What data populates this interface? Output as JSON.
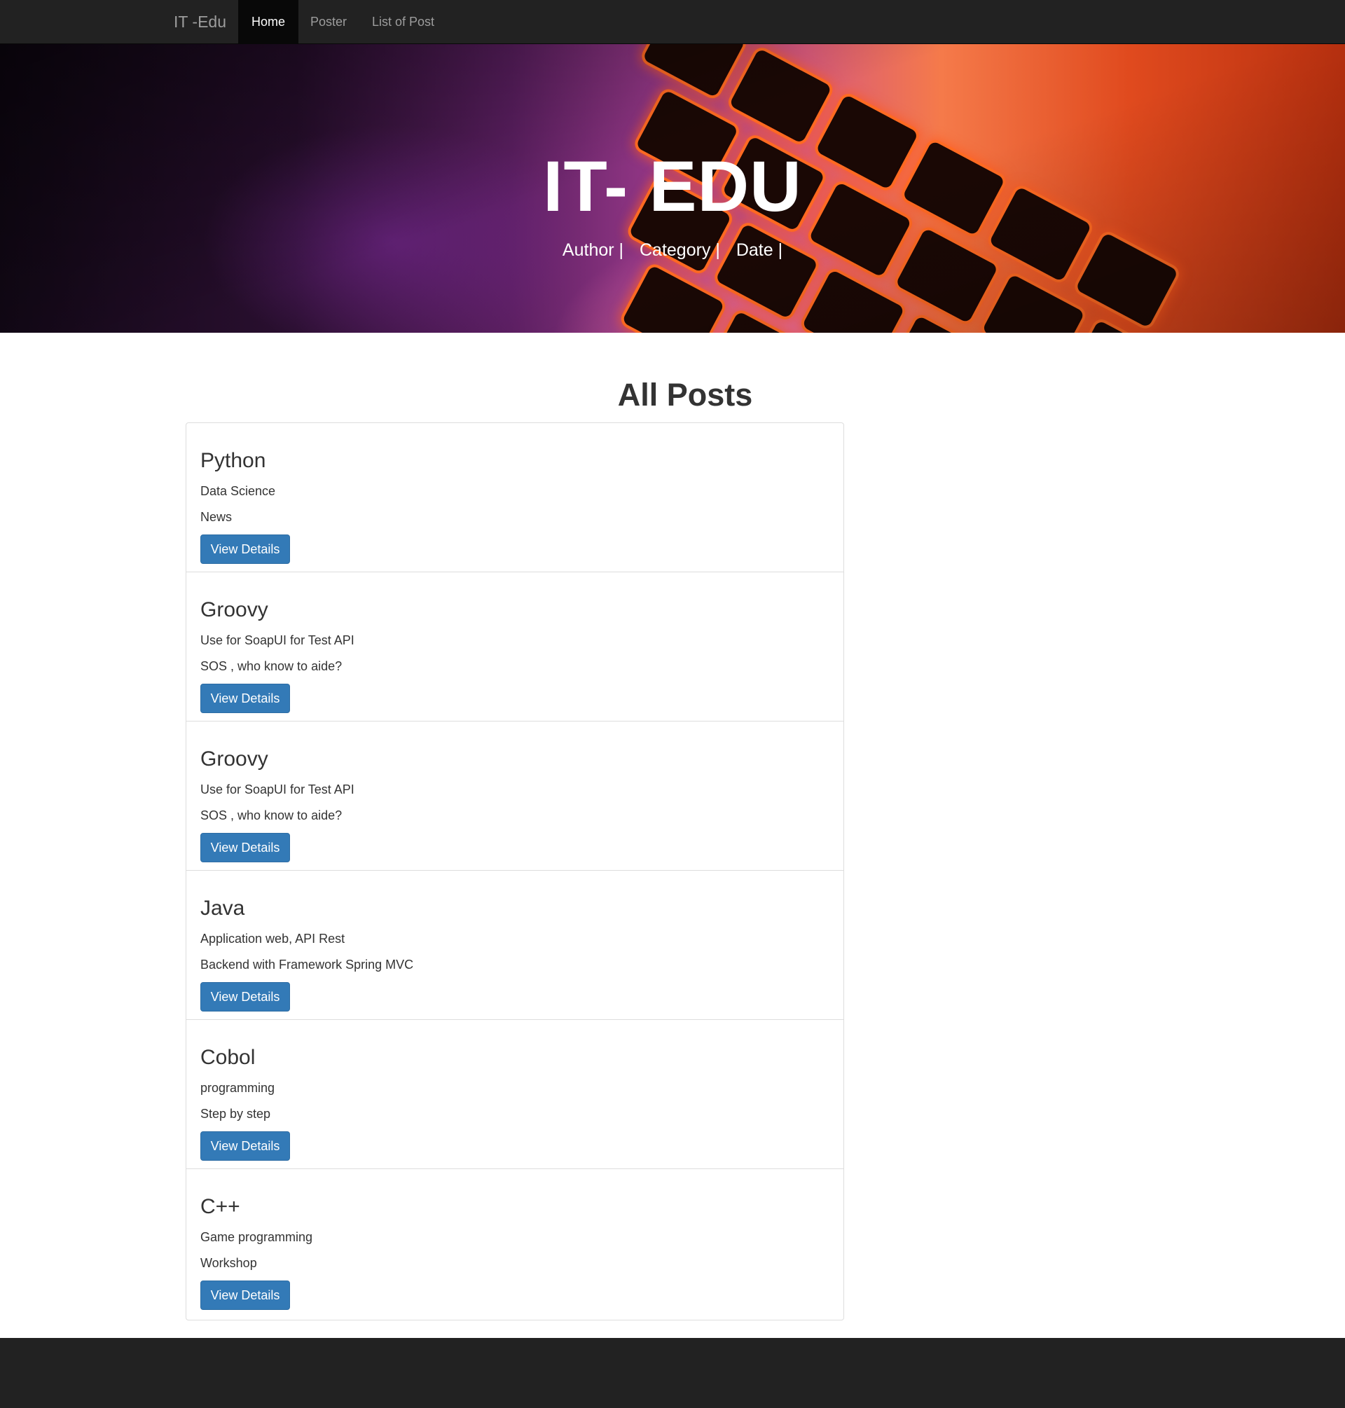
{
  "navbar": {
    "brand": "IT -Edu",
    "items": [
      {
        "label": "Home",
        "active": true
      },
      {
        "label": "Poster",
        "active": false
      },
      {
        "label": "List of Post",
        "active": false
      }
    ]
  },
  "hero": {
    "title": "IT- EDU",
    "meta": [
      "Author |",
      "Category |",
      "Date |"
    ]
  },
  "main": {
    "section_title": "All Posts",
    "view_details_label": "View Details",
    "posts": [
      {
        "title": "Python",
        "line1": "Data Science",
        "line2": "News"
      },
      {
        "title": "Groovy",
        "line1": "Use for SoapUI for Test API",
        "line2": "SOS , who know to aide?"
      },
      {
        "title": "Groovy",
        "line1": "Use for SoapUI for Test API",
        "line2": "SOS , who know to aide?"
      },
      {
        "title": "Java",
        "line1": "Application web, API Rest",
        "line2": "Backend with Framework Spring MVC"
      },
      {
        "title": "Cobol",
        "line1": "programming",
        "line2": "Step by step"
      },
      {
        "title": "C++",
        "line1": "Game programming",
        "line2": "Workshop"
      }
    ]
  },
  "colors": {
    "navbar_bg": "#222222",
    "button_primary": "#337ab7",
    "footer_bg": "#222222"
  }
}
